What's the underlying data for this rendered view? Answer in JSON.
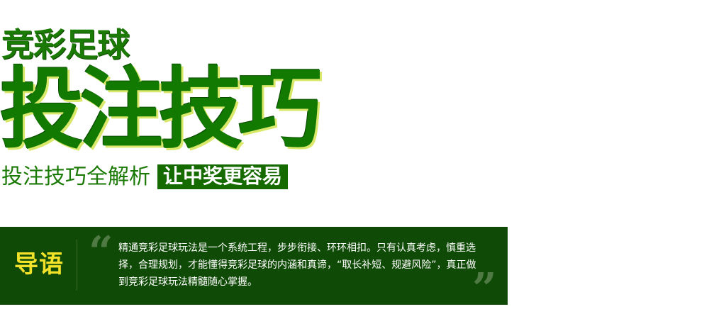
{
  "hero": {
    "subtitle": "竞彩足球",
    "title": "投注技巧",
    "tagline": "投注技巧全解析",
    "tagline_highlight": "让中奖更容易"
  },
  "intro": {
    "label": "导语",
    "quote_open": "“",
    "quote_close": "”",
    "text": "精通竞彩足球玩法是一个系统工程，步步衔接、环环相扣。只有认真考虑，慎重选择，合理规划，才能懂得竞彩足球的内涵和真谛，“取长补短、规避风险”，真正做到竞彩足球玩法精髓随心掌握。"
  },
  "colors": {
    "brand_green": "#127a00",
    "bar_green": "#0f4a06",
    "label_yellow": "#f3e22a"
  }
}
